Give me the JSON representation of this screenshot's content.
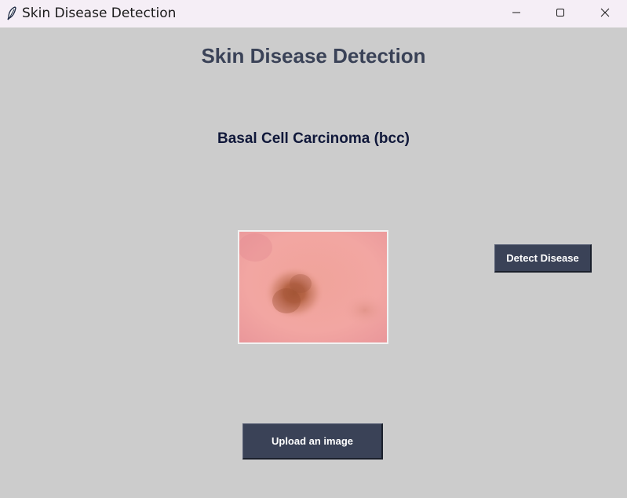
{
  "window": {
    "title": "Skin Disease Detection",
    "icon": "feather-icon",
    "controls": [
      "minimize-icon",
      "maximize-icon",
      "close-icon"
    ]
  },
  "main": {
    "heading": "Skin Disease Detection",
    "result_label": "Basal Cell Carcinoma (bcc)",
    "preview_image": "skin-lesion-image",
    "detect_button": "Detect Disease",
    "upload_button": "Upload an image"
  },
  "colors": {
    "background": "#cccccc",
    "titlebar": "#f5eef6",
    "heading": "#3a4257",
    "result": "#10183a",
    "button": "#3a4257",
    "button_text": "#ffffff"
  }
}
